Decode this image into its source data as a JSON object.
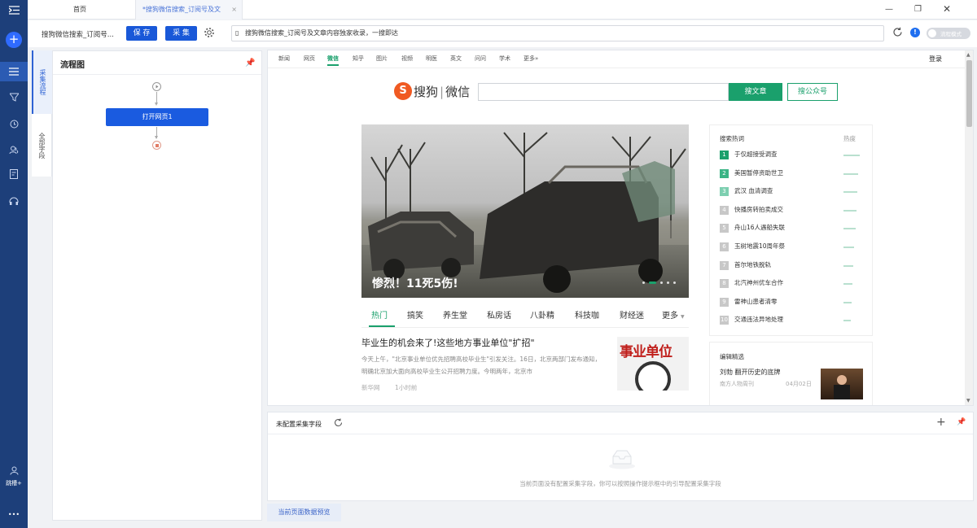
{
  "window": {
    "tabs": [
      {
        "label": "首页"
      },
      {
        "label": "*搜狗微信搜索_订阅号及文"
      }
    ]
  },
  "toolbar": {
    "task_name": "搜狗微信搜索_订阅号...",
    "save_label": "保 存",
    "collect_label": "采 集",
    "url": "搜狗微信搜索_订阅号及文章内容独家收录，一搜即达",
    "mode_label": "流程模式"
  },
  "sidebar": {
    "user_label": "跳槽+",
    "more_label": "•••"
  },
  "side_tabs": [
    {
      "label": "采集流程"
    },
    {
      "label": "全部字段"
    }
  ],
  "flow": {
    "title": "流程图",
    "node_label": "打开网页1"
  },
  "site": {
    "nav": [
      "新闻",
      "网页",
      "微信",
      "知乎",
      "图片",
      "视频",
      "明医",
      "英文",
      "问问",
      "学术",
      "更多»"
    ],
    "login": "登录",
    "logo_text": "搜狗",
    "logo_sub": "微信",
    "search_article_btn": "搜文章",
    "search_account_btn": "搜公众号",
    "hero_caption": "惨烈！11死5伤!",
    "categories": [
      "热门",
      "搞笑",
      "养生堂",
      "私房话",
      "八卦精",
      "科技咖",
      "财经迷",
      "更多"
    ],
    "article": {
      "title": "毕业生的机会来了!这些地方事业单位\"扩招\"",
      "summary": "今天上午，\"北京事业单位优先招聘高校毕业生\"引发关注。16日，北京两部门发布通知，明确北京加大面向高校毕业生公开招聘力度。今明两年，北京市",
      "source": "新华网",
      "time": "1小时前",
      "thumb_text": "事业单位"
    },
    "hot": {
      "title": "搜索热词",
      "heat_label": "热度",
      "items": [
        {
          "rank": "1",
          "text": "于仅超接受调查",
          "heat": 0.9
        },
        {
          "rank": "2",
          "text": "美国暂停资助世卫",
          "heat": 0.82
        },
        {
          "rank": "3",
          "text": "武汉 血清调查",
          "heat": 0.78
        },
        {
          "rank": "4",
          "text": "快播房转拍卖成交",
          "heat": 0.72
        },
        {
          "rank": "5",
          "text": "舟山16人遇船失联",
          "heat": 0.68
        },
        {
          "rank": "6",
          "text": "玉树地震10周年祭",
          "heat": 0.6
        },
        {
          "rank": "7",
          "text": "首尔地铁脱轨",
          "heat": 0.55
        },
        {
          "rank": "8",
          "text": "北汽神州优车合作",
          "heat": 0.5
        },
        {
          "rank": "9",
          "text": "雷神山患者清零",
          "heat": 0.46
        },
        {
          "rank": "10",
          "text": "交通违法异地处理",
          "heat": 0.42
        }
      ]
    },
    "editor": {
      "title": "编辑精选",
      "item_title": "刘勃  翻开历史的底牌",
      "item_source": "南方人物周刊",
      "item_date": "04月02日"
    }
  },
  "bottom": {
    "title": "未配置采集字段",
    "empty_text": "当前页面没有配置采集字段，你可以按照操作提示框中的引导配置采集字段",
    "preview_label": "当前页面数据预览"
  },
  "colors": {
    "nav": "#1d3f7a",
    "accent": "#1958d8",
    "sogou_green": "#1aa06c",
    "sogou_orange": "#f05a22"
  }
}
